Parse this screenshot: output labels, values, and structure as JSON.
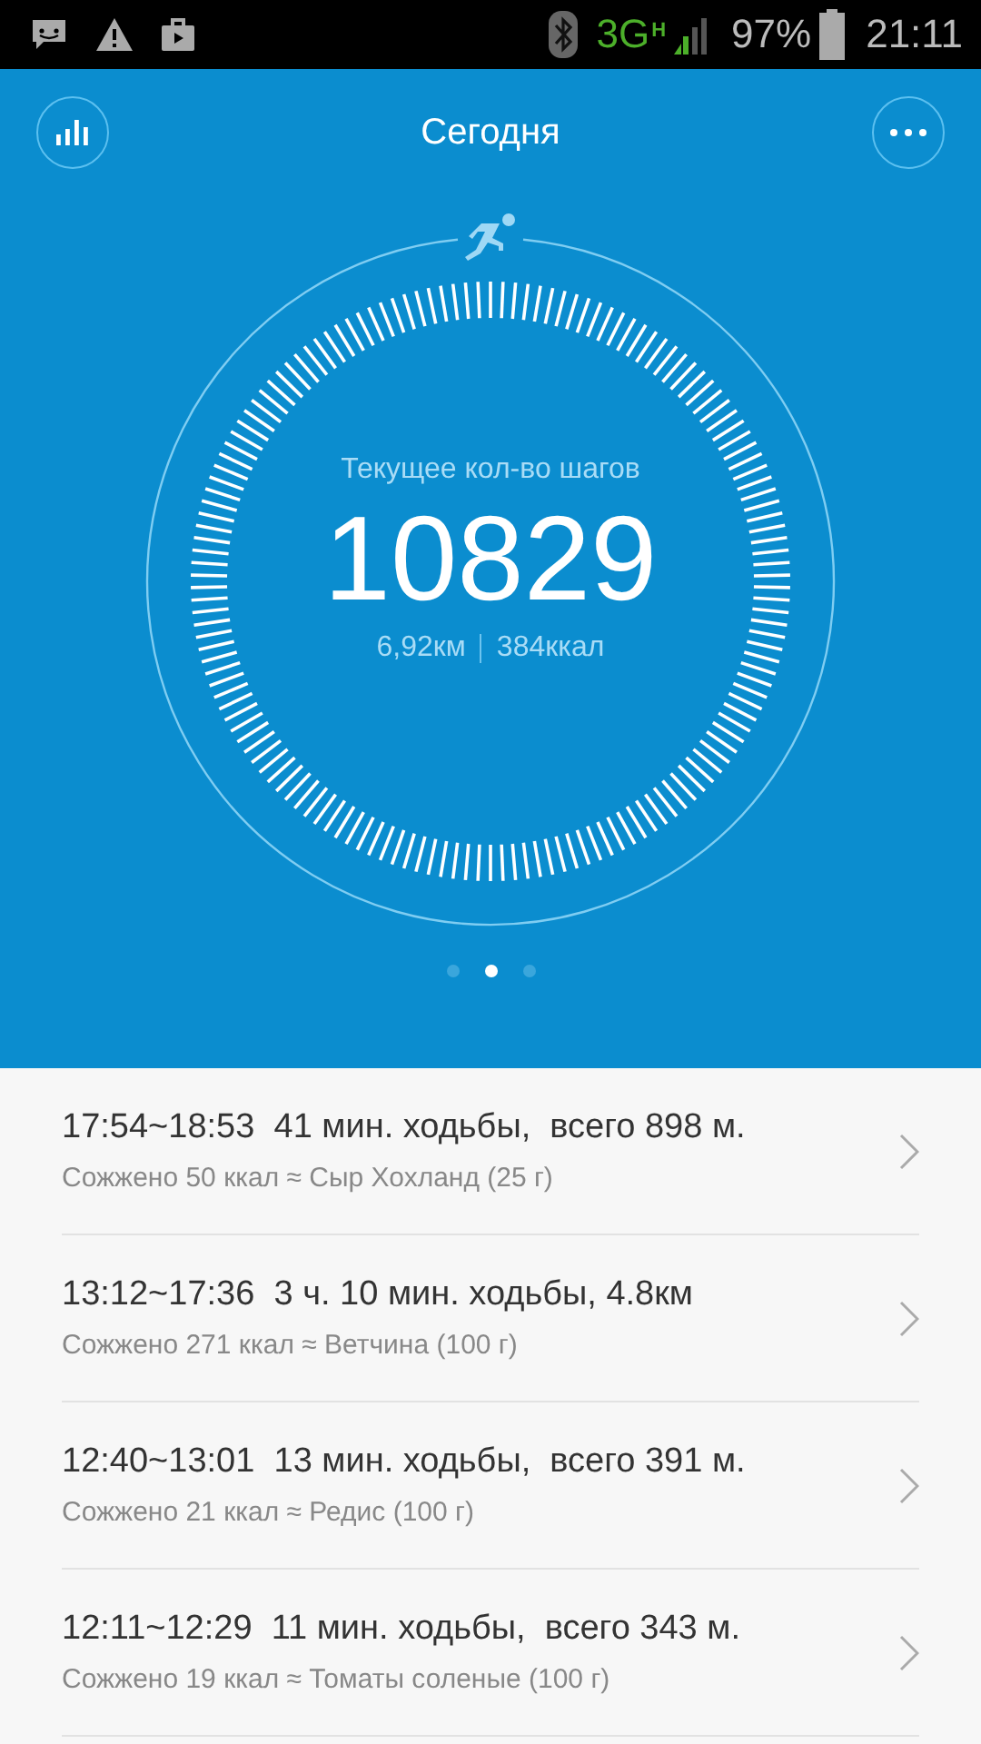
{
  "status_bar": {
    "network": "3G",
    "network_sub": "H",
    "battery": "97%",
    "time": "21:11"
  },
  "header": {
    "title": "Сегодня"
  },
  "summary": {
    "label": "Текущее кол-во шагов",
    "steps": "10829",
    "distance": "6,92км",
    "calories": "384ккал"
  },
  "pages": [
    {
      "selected": false
    },
    {
      "selected": true
    },
    {
      "selected": false
    }
  ],
  "activities": [
    {
      "title": "17:54~18:53  41 мин. ходьбы,  всего 898 м.",
      "detail": "Сожжено 50 ккал ≈ Сыр Хохланд (25 г)"
    },
    {
      "title": "13:12~17:36  3 ч. 10 мин. ходьбы, 4.8км",
      "detail": "Сожжено 271 ккал ≈ Ветчина (100 г)"
    },
    {
      "title": "12:40~13:01  13 мин. ходьбы,  всего 391 м.",
      "detail": "Сожжено 21 ккал ≈ Редис (100 г)"
    },
    {
      "title": "12:11~12:29  11 мин. ходьбы,  всего 343 м.",
      "detail": "Сожжено 19 ккал ≈ Томаты соленые (100 г)"
    }
  ]
}
